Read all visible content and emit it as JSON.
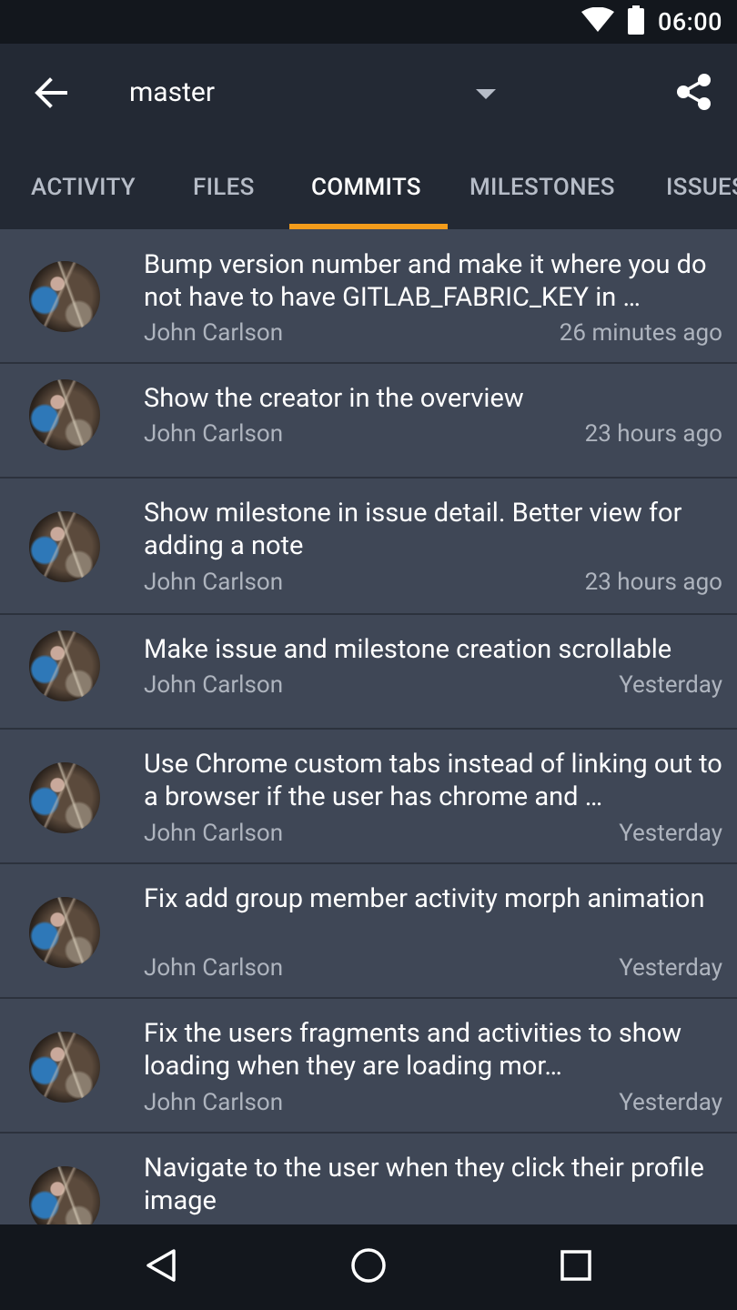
{
  "status_bar": {
    "time": "06:00",
    "icons": [
      "wifi-icon",
      "battery-icon"
    ]
  },
  "toolbar": {
    "branch": "master",
    "back_icon": "arrow-left-icon",
    "dropdown_icon": "caret-down-icon",
    "share_icon": "share-icon"
  },
  "tabs": [
    {
      "label": "ACTIVITY",
      "active": false
    },
    {
      "label": "FILES",
      "active": false
    },
    {
      "label": "COMMITS",
      "active": true
    },
    {
      "label": "MILESTONES",
      "active": false
    },
    {
      "label": "ISSUES",
      "active": false
    }
  ],
  "commits": [
    {
      "title": "Bump version number and make it where you do not have to have GITLAB_FABRIC_KEY in …",
      "author": "John Carlson",
      "time": "26 minutes ago"
    },
    {
      "title": "Show the creator in the overview",
      "author": "John Carlson",
      "time": "23 hours ago"
    },
    {
      "title": "Show milestone in issue detail. Better view for adding a note",
      "author": "John Carlson",
      "time": "23 hours ago"
    },
    {
      "title": "Make issue and milestone creation scrollable",
      "author": "John Carlson",
      "time": "Yesterday"
    },
    {
      "title": "Use Chrome custom tabs instead of linking out to a browser if the user has chrome and …",
      "author": "John Carlson",
      "time": "Yesterday"
    },
    {
      "title": "Fix add group member activity morph animation",
      "author": "John Carlson",
      "time": "Yesterday"
    },
    {
      "title": "Fix the users fragments and activities to show loading when they are loading mor…",
      "author": "John Carlson",
      "time": "Yesterday"
    },
    {
      "title": "Navigate to the user when they click their profile image",
      "author": "",
      "time": ""
    }
  ],
  "nav_bar": {
    "icons": [
      "back-triangle-icon",
      "home-circle-icon",
      "recents-square-icon"
    ]
  },
  "colors": {
    "accent": "#f39c1b",
    "toolbar": "#232934",
    "list_bg": "#3f4756",
    "status_bar": "#13171d"
  }
}
